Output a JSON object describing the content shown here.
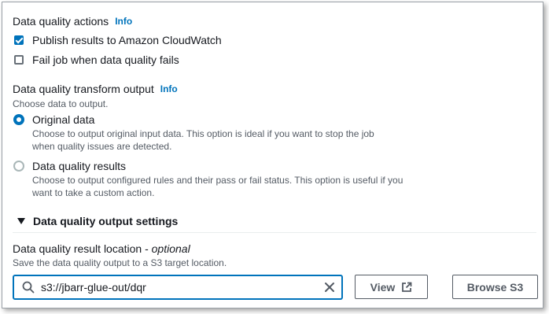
{
  "actions": {
    "heading": "Data quality actions",
    "info": "Info",
    "publish_label": "Publish results to Amazon CloudWatch",
    "publish_checked": true,
    "fail_label": "Fail job when data quality fails",
    "fail_checked": false
  },
  "transform_output": {
    "heading": "Data quality transform output",
    "info": "Info",
    "description": "Choose data to output.",
    "options": [
      {
        "title": "Original data",
        "description_line1": "Choose to output original input data. This option is ideal if you want to stop the job",
        "description_line2": "when quality issues are detected.",
        "selected": true
      },
      {
        "title": "Data quality results",
        "description_line1": "Choose to output configured rules and their pass or fail status. This option is useful if you",
        "description_line2": "want to take a custom action.",
        "selected": false
      }
    ]
  },
  "output_settings": {
    "expander_label": "Data quality output settings",
    "location_label": "Data quality result location - ",
    "location_optional": "optional",
    "location_description": "Save the data quality output to a S3 target location.",
    "location_value": "s3://jbarr-glue-out/dqr",
    "view_button": "View",
    "browse_button": "Browse S3"
  },
  "colors": {
    "accent": "#0073bb",
    "text": "#16191f",
    "secondary_text": "#545b64"
  }
}
